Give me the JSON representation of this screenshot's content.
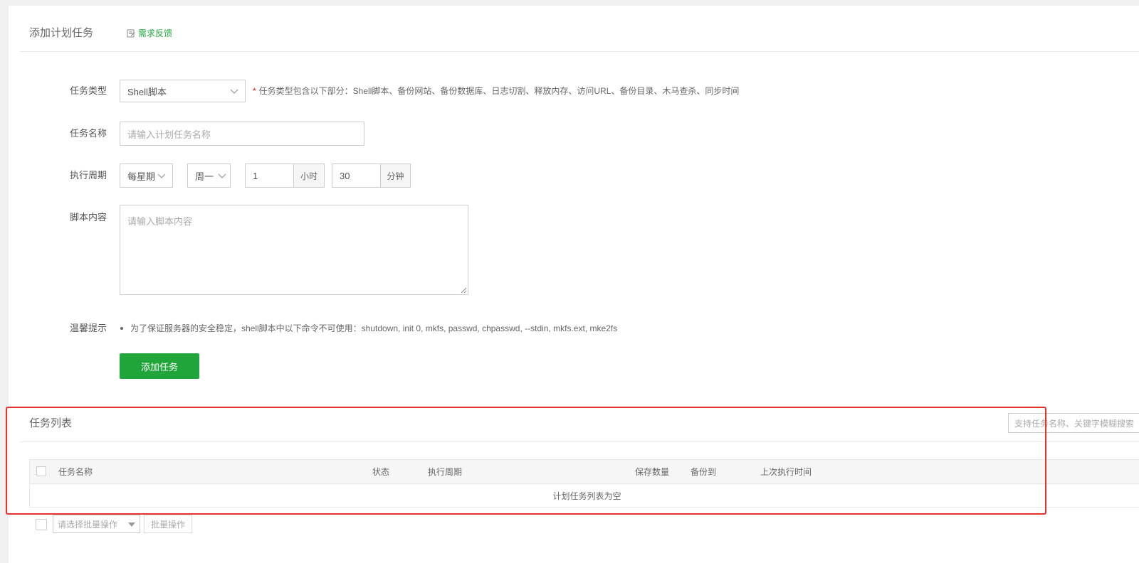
{
  "add_task": {
    "title": "添加计划任务",
    "feedback_label": "需求反馈"
  },
  "form": {
    "task_type": {
      "label": "任务类型",
      "value": "Shell脚本",
      "hint_star": "*",
      "hint": "任务类型包含以下部分：Shell脚本、备份网站、备份数据库、日志切割、释放内存、访问URL、备份目录、木马查杀、同步时间"
    },
    "task_name": {
      "label": "任务名称",
      "placeholder": "请输入计划任务名称",
      "value": ""
    },
    "cycle": {
      "label": "执行周期",
      "period": "每星期",
      "weekday": "周一",
      "hour": "1",
      "hour_unit": "小时",
      "minute": "30",
      "minute_unit": "分钟"
    },
    "script": {
      "label": "脚本内容",
      "placeholder": "请输入脚本内容"
    },
    "tip": {
      "label": "温馨提示",
      "text": "为了保证服务器的安全稳定，shell脚本中以下命令不可使用：shutdown, init 0, mkfs, passwd, chpasswd, --stdin, mkfs.ext, mke2fs"
    },
    "submit_label": "添加任务"
  },
  "task_list": {
    "title": "任务列表",
    "search_placeholder": "支持任务名称、关键字模糊搜索",
    "columns": [
      "任务名称",
      "状态",
      "执行周期",
      "保存数量",
      "备份到",
      "上次执行时间"
    ],
    "empty_text": "计划任务列表为空",
    "batch_placeholder": "请选择批量操作",
    "batch_button": "批量操作"
  },
  "colors": {
    "accent": "#20a53a",
    "highlight_frame": "#e5322d"
  }
}
